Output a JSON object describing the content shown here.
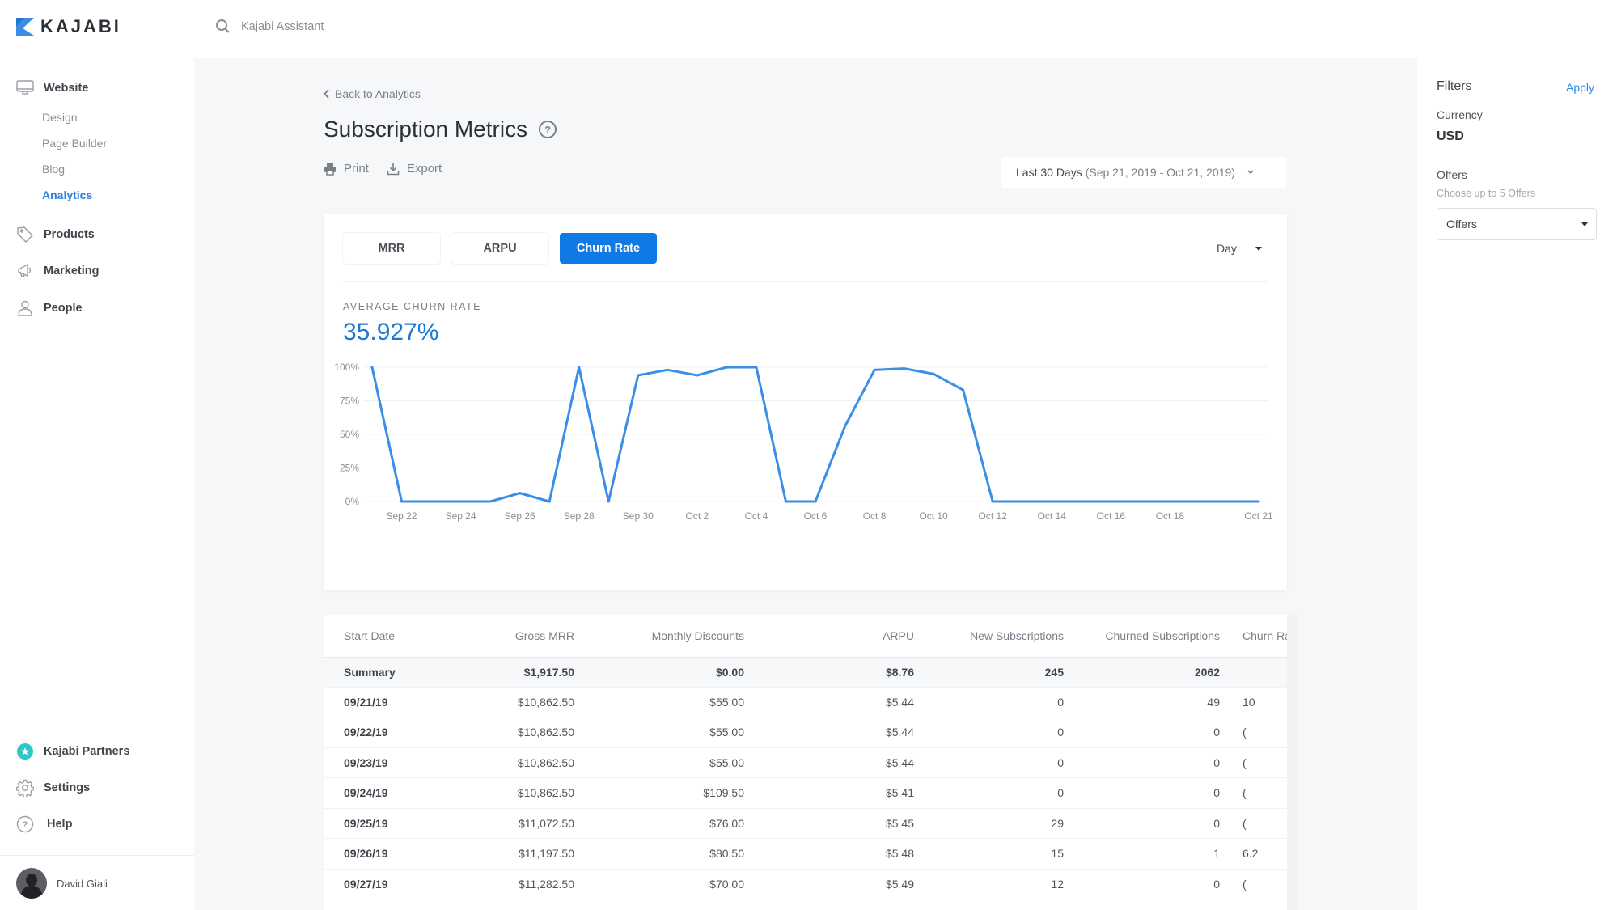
{
  "brand": {
    "name": "KAJABI",
    "accent": "#1f78d1"
  },
  "topbar": {
    "search_placeholder": "Kajabi Assistant"
  },
  "sidebar": {
    "sections": [
      {
        "label": "Website",
        "icon": "monitor-icon",
        "children": [
          {
            "label": "Design",
            "active": false
          },
          {
            "label": "Page Builder",
            "active": false
          },
          {
            "label": "Blog",
            "active": false
          },
          {
            "label": "Analytics",
            "active": true
          }
        ]
      },
      {
        "label": "Products",
        "icon": "tag-icon"
      },
      {
        "label": "Marketing",
        "icon": "megaphone-icon"
      },
      {
        "label": "People",
        "icon": "person-icon"
      }
    ],
    "bottom": [
      {
        "label": "Kajabi Partners",
        "icon": "star-badge-icon"
      },
      {
        "label": "Settings",
        "icon": "gear-icon"
      },
      {
        "label": "Help",
        "icon": "help-icon"
      }
    ],
    "user": {
      "name": "David Giali"
    }
  },
  "page": {
    "back_label": "Back to Analytics",
    "title": "Subscription Metrics",
    "help_glyph": "?",
    "actions": {
      "print": "Print",
      "export": "Export"
    },
    "date_range": {
      "label": "Last 30 Days",
      "range": "(Sep 21, 2019 - Oct 21, 2019)"
    }
  },
  "metrics": {
    "tabs": [
      {
        "label": "MRR",
        "active": false
      },
      {
        "label": "ARPU",
        "active": false
      },
      {
        "label": "Churn Rate",
        "active": true
      }
    ],
    "period": "Day",
    "summary_label": "AVERAGE CHURN RATE",
    "summary_value": "35.927%"
  },
  "chart_data": {
    "type": "line",
    "title": "",
    "xlabel": "",
    "ylabel": "",
    "ylim": [
      0,
      100
    ],
    "yticks": [
      "0%",
      "25%",
      "50%",
      "75%",
      "100%"
    ],
    "xtick_labels": [
      "Sep 22",
      "Sep 24",
      "Sep 26",
      "Sep 28",
      "Sep 30",
      "Oct 2",
      "Oct 4",
      "Oct 6",
      "Oct 8",
      "Oct 10",
      "Oct 12",
      "Oct 14",
      "Oct 16",
      "Oct 18",
      "Oct 21"
    ],
    "grid": true,
    "color": "#3a8ee6",
    "x": [
      "Sep 21",
      "Sep 22",
      "Sep 23",
      "Sep 24",
      "Sep 25",
      "Sep 26",
      "Sep 27",
      "Sep 28",
      "Sep 29",
      "Sep 30",
      "Oct 1",
      "Oct 2",
      "Oct 3",
      "Oct 4",
      "Oct 5",
      "Oct 6",
      "Oct 7",
      "Oct 8",
      "Oct 9",
      "Oct 10",
      "Oct 11",
      "Oct 12",
      "Oct 13",
      "Oct 14",
      "Oct 15",
      "Oct 16",
      "Oct 17",
      "Oct 18",
      "Oct 19",
      "Oct 20",
      "Oct 21"
    ],
    "series": [
      {
        "name": "Churn Rate",
        "values": [
          100,
          0,
          0,
          0,
          0,
          6.25,
          0,
          100,
          0,
          94,
          98,
          94,
          100,
          100,
          0,
          0,
          56,
          98,
          99,
          95,
          83,
          0,
          0,
          0,
          0,
          0,
          0,
          0,
          0,
          0,
          0
        ]
      }
    ]
  },
  "table": {
    "columns": [
      "Start Date",
      "Gross MRR",
      "Monthly Discounts",
      "ARPU",
      "New Subscriptions",
      "Churned Subscriptions",
      "Churn Ra"
    ],
    "summary": [
      "Summary",
      "$1,917.50",
      "$0.00",
      "$8.76",
      "245",
      "2062",
      ""
    ],
    "rows": [
      [
        "09/21/19",
        "$10,862.50",
        "$55.00",
        "$5.44",
        "0",
        "49",
        "10"
      ],
      [
        "09/22/19",
        "$10,862.50",
        "$55.00",
        "$5.44",
        "0",
        "0",
        "("
      ],
      [
        "09/23/19",
        "$10,862.50",
        "$55.00",
        "$5.44",
        "0",
        "0",
        "("
      ],
      [
        "09/24/19",
        "$10,862.50",
        "$109.50",
        "$5.41",
        "0",
        "0",
        "("
      ],
      [
        "09/25/19",
        "$11,072.50",
        "$76.00",
        "$5.45",
        "29",
        "0",
        "("
      ],
      [
        "09/26/19",
        "$11,197.50",
        "$80.50",
        "$5.48",
        "15",
        "1",
        "6.2"
      ],
      [
        "09/27/19",
        "$11,282.50",
        "$70.00",
        "$5.49",
        "12",
        "0",
        "("
      ]
    ]
  },
  "filters": {
    "title": "Filters",
    "apply_label": "Apply",
    "currency_label": "Currency",
    "currency_value": "USD",
    "offers_label": "Offers",
    "offers_hint": "Choose up to 5 Offers",
    "offers_select_value": "Offers"
  }
}
